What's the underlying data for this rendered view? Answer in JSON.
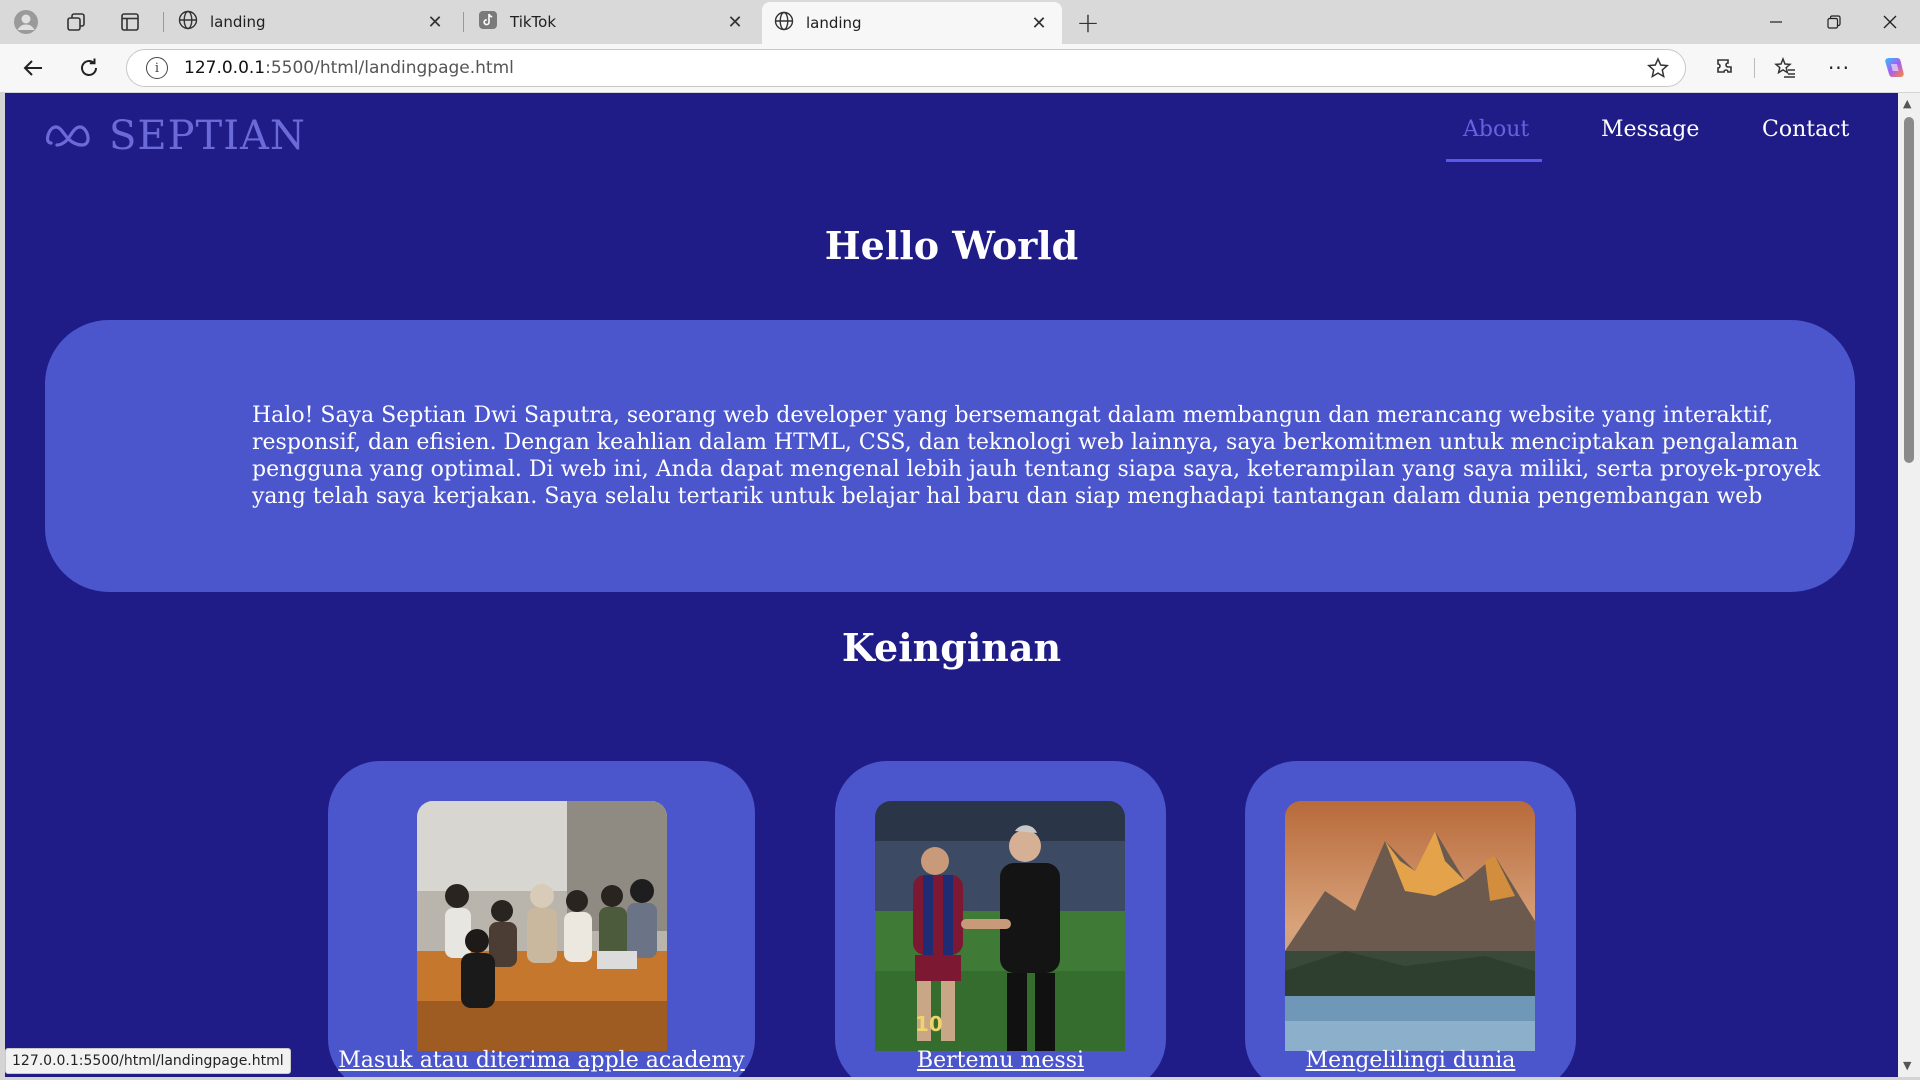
{
  "browser": {
    "tabs": [
      {
        "title": "landing",
        "icon": "globe-icon",
        "active": false
      },
      {
        "title": "TikTok",
        "icon": "tiktok-icon",
        "active": false
      },
      {
        "title": "landing",
        "icon": "globe-icon",
        "active": true
      }
    ],
    "new_tab_symbol": "+",
    "close_symbol": "✕",
    "url_host": "127.0.0.1",
    "url_rest": ":5500/html/landingpage.html",
    "status_url": "127.0.0.1:5500/html/landingpage.html"
  },
  "page": {
    "logo_text": "SEPTIAN",
    "nav": [
      {
        "label": "About",
        "active": true
      },
      {
        "label": "Message",
        "active": false
      },
      {
        "label": "Contact",
        "active": false
      }
    ],
    "hero_title": "Hello World",
    "about_text": "Halo! Saya Septian Dwi Saputra, seorang web developer yang bersemangat dalam membangun dan merancang website yang interaktif, responsif, dan efisien. Dengan keahlian dalam HTML, CSS, dan teknologi web lainnya, saya berkomitmen untuk menciptakan pengalaman pengguna yang optimal. Di web ini, Anda dapat mengenal lebih jauh tentang siapa saya, keterampilan yang saya miliki, serta proyek-proyek yang telah saya kerjakan. Saya selalu tertarik untuk belajar hal baru dan siap menghadapi tantangan dalam dunia pengembangan web",
    "wishes_title": "Keinginan",
    "wishes": [
      {
        "caption": "Masuk atau diterima apple academy"
      },
      {
        "caption": "Bertemu messi"
      },
      {
        "caption": "Mengelilingi dunia"
      }
    ]
  },
  "colors": {
    "page_bg": "#201c87",
    "card_bg": "#4b55cc",
    "nav_active": "#6663e0",
    "logo": "#6b6ad9"
  }
}
